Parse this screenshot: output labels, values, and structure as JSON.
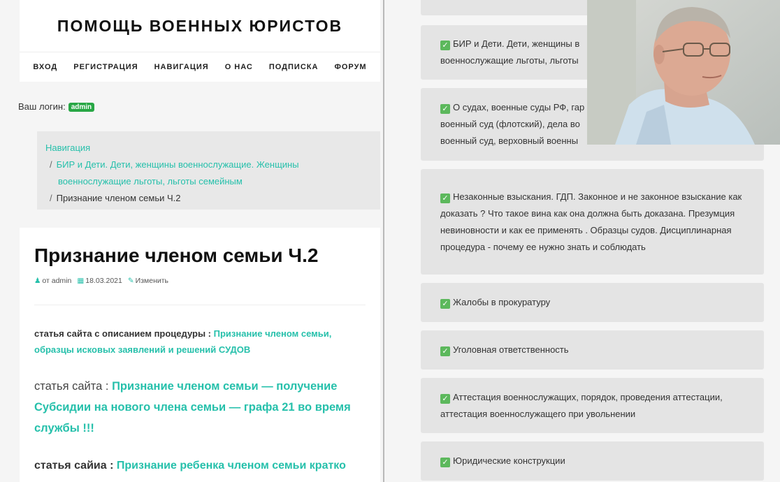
{
  "site": {
    "title": "ПОМОЩЬ ВОЕННЫХ ЮРИСТОВ",
    "nav": [
      "ВХОД",
      "РЕГИСТРАЦИЯ",
      "НАВИГАЦИЯ",
      "О НАС",
      "ПОДПИСКА",
      "ФОРУМ"
    ]
  },
  "login": {
    "label": "Ваш логин:",
    "user": "admin"
  },
  "breadcrumb": {
    "root": "Навигация",
    "parent_line1": "БИР и Дети. Дети, женщины военнослужащие. Женщины",
    "parent_line2": "военнослужащие льготы, льготы семейным",
    "current": "Признание членом семьи Ч.2"
  },
  "post": {
    "title": "Признание членом семьи Ч.2",
    "author": "от admin",
    "date": "18.03.2021",
    "edit": "Изменить",
    "p1_label": "статья сайта с описанием процедуры :",
    "p1_link": "Признание членом семьи, образцы исковых заявлений и решений СУДОВ",
    "p2_label": "статья сайта :",
    "p2_link": "Признание членом семьи — получение Субсидии на нового члена семьи — графа 21 во время службы !!!",
    "p3_label": "статья сайиа :",
    "p3_link": "Признание ребенка членом семьи кратко"
  },
  "cards": [
    {
      "line1": "БИР и Дети. Дети, женщины в",
      "line2": "военнослужащие льготы, льготы"
    },
    {
      "line1": "О судах, военные суды РФ, гар",
      "line2": "военный суд (флотский), дела во",
      "line3": "военный суд, верховный военны"
    },
    {
      "text": "Незаконные взыскания. ГДП. Законное и не законное взыскание как доказать ? Что такое вина как она должна быть доказана. Презумция невиновности и как ее применять . Образцы судов. Дисциплинарная процедура - почему ее нужно знать и соблюдать"
    },
    {
      "text": "Жалобы в прокуратуру"
    },
    {
      "text": "Уголовная ответственность"
    },
    {
      "text": "Аттестация военнослужащих, порядок, проведения аттестации, аттестация военнослужащего при увольнении"
    },
    {
      "text": "Юридические конструкции"
    }
  ],
  "icons": {
    "check": "check-mark-icon",
    "user": "user-icon",
    "calendar": "calendar-icon",
    "edit": "edit-icon"
  },
  "colors": {
    "accent": "#26c0ab",
    "badge": "#28a745",
    "check": "#5cb85c"
  }
}
